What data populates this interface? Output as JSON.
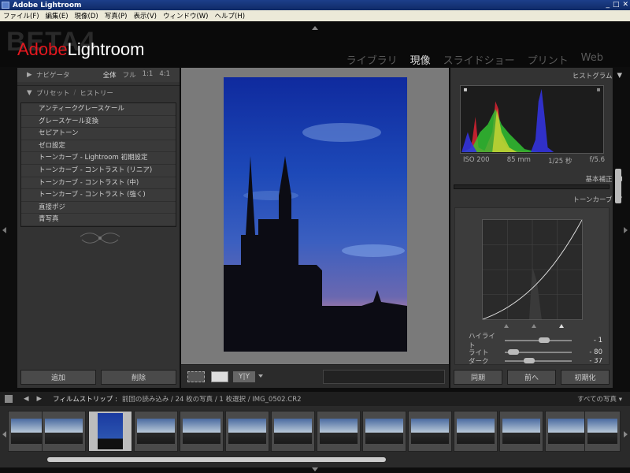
{
  "window": {
    "title": "Adobe Lightroom",
    "controls": [
      "_",
      "□",
      "✕"
    ]
  },
  "menu": [
    "ファイル(F)",
    "編集(E)",
    "現像(D)",
    "写真(P)",
    "表示(V)",
    "ウィンドウ(W)",
    "ヘルプ(H)"
  ],
  "brand": {
    "beta": "BETA4",
    "adobe": "Adobe",
    "product": "Lightroom"
  },
  "modules": [
    {
      "label": "ライブラリ",
      "active": false
    },
    {
      "label": "現像",
      "active": true
    },
    {
      "label": "スライドショー",
      "active": false
    },
    {
      "label": "プリント",
      "active": false
    },
    {
      "label": "Web",
      "active": false
    }
  ],
  "left": {
    "navigator": {
      "label": "ナビゲータ",
      "zoom": [
        "全体",
        "フル",
        "1:1",
        "4:1"
      ]
    },
    "presets_label": "プリセット",
    "history_label": "ヒストリー",
    "presets": [
      "アンティークグレースケール",
      "グレースケール変換",
      "セピアトーン",
      "ゼロ設定",
      "トーンカーブ - Lightroom 初期設定",
      "トーンカーブ - コントラスト (リニア)",
      "トーンカーブ - コントラスト (中)",
      "トーンカーブ - コントラスト (強く)",
      "直接ポジ",
      "青写真"
    ],
    "add_button": "追加",
    "delete_button": "削除"
  },
  "right": {
    "histogram_label": "ヒストグラム",
    "exif": {
      "iso": "ISO 200",
      "focal": "85 mm",
      "shutter": "1/25 秒",
      "aperture": "f/5.6"
    },
    "basic_label": "基本補正",
    "tonecurve_label": "トーンカーブ",
    "sliders": [
      {
        "label": "ハイライト",
        "value": "- 1",
        "pos": 0.45
      },
      {
        "label": "ライト",
        "value": "- 80",
        "pos": 0.1
      },
      {
        "label": "ダーク",
        "value": "- 37",
        "pos": 0.3
      }
    ],
    "sync_button": "同期",
    "prev_button": "前へ",
    "reset_button": "初期化"
  },
  "filmstrip": {
    "label": "フィルムストリップ :",
    "info": "前回の読み込み / 24 枚の写真 / 1 枚選択 / IMG_0502.CR2",
    "filter": "すべての写真"
  },
  "colors": {
    "accent": "#e4181f",
    "panel": "#333333"
  }
}
